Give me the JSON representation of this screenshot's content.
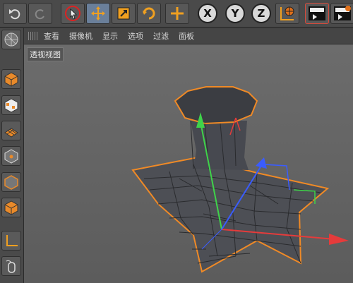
{
  "menubar": {
    "items": [
      "查看",
      "摄像机",
      "显示",
      "选项",
      "过滤",
      "面板"
    ]
  },
  "viewport": {
    "label": "透视视图"
  },
  "toolbar": {
    "axis_x": "X",
    "axis_y": "Y",
    "axis_z": "Z"
  },
  "colors": {
    "x_axis": "#e53b3b",
    "y_axis": "#3fd34a",
    "z_axis": "#3a5cff",
    "selection_outline": "#f08a26",
    "active_tool": "#6a7f9a"
  },
  "icons": [
    "undo-icon",
    "redo-icon",
    "select-icon",
    "move-icon",
    "scale-icon",
    "rotate-icon",
    "add-move-icon",
    "world-coord-icon",
    "render-view-icon",
    "render-pic-icon"
  ]
}
